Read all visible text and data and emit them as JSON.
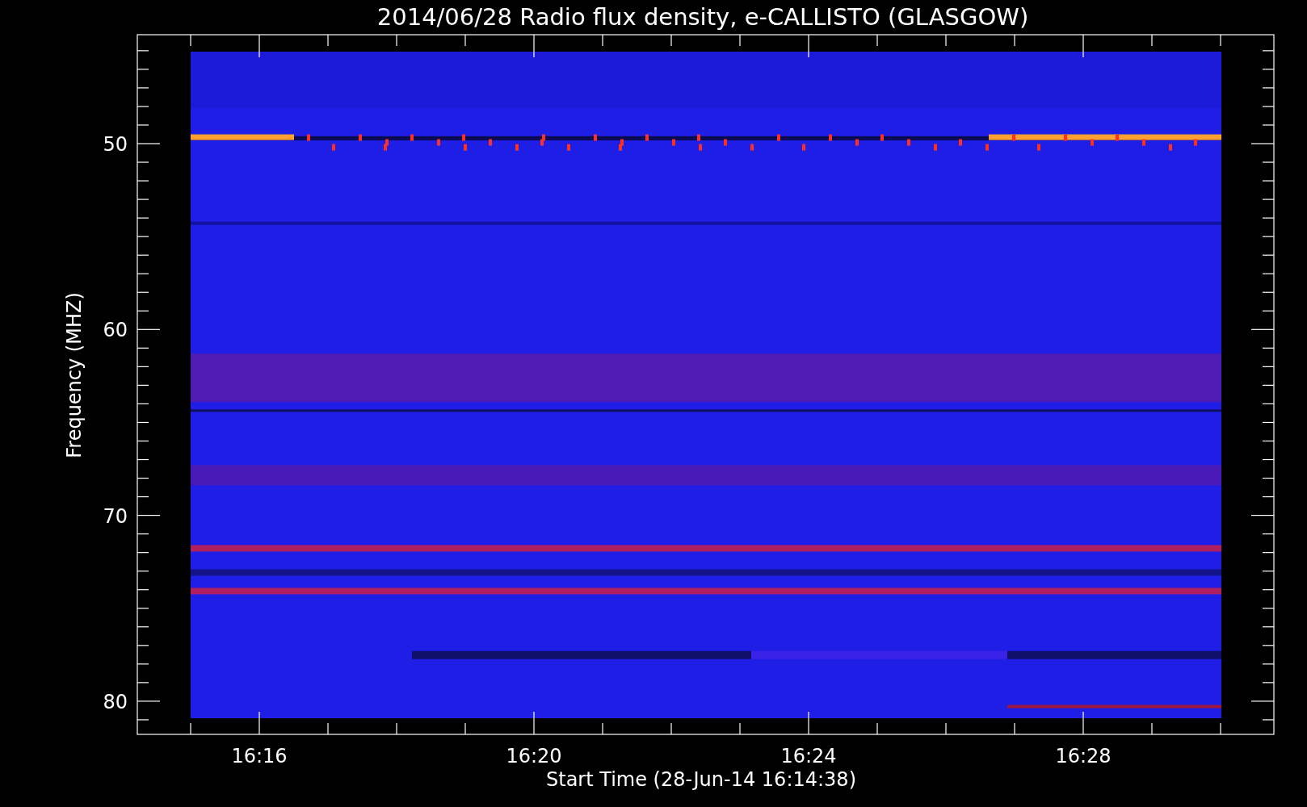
{
  "title": "2014/06/28  Radio flux density, e-CALLISTO (GLASGOW)",
  "plot": {
    "ylabel": "Frequency (MHZ)",
    "xlabel": "Start Time (28-Jun-14 16:14:38)",
    "yticks": [
      "50",
      "60",
      "70",
      "80"
    ],
    "xticks": [
      "16:16",
      "16:20",
      "16:24",
      "16:28"
    ]
  }
}
